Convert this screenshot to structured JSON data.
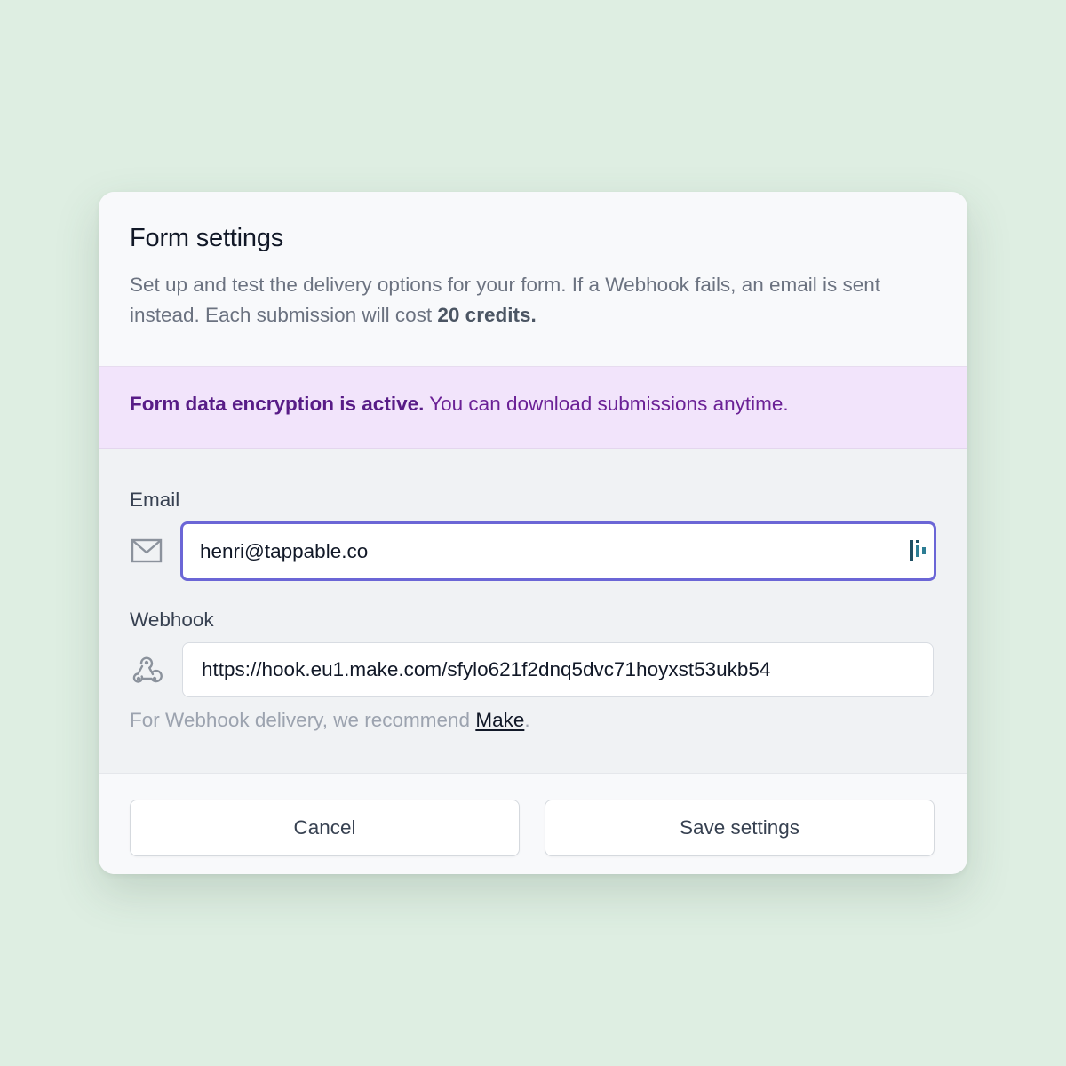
{
  "dialog": {
    "title": "Form settings",
    "description_prefix": "Set up and test the delivery options for your form. If a Webhook fails, an email is sent instead. Each submission will cost ",
    "description_bold": "20 credits."
  },
  "banner": {
    "strong": "Form data encryption is active.",
    "text": " You can download submissions anytime."
  },
  "email": {
    "label": "Email",
    "value": "henri@tappable.co",
    "icon": "envelope-icon"
  },
  "webhook": {
    "label": "Webhook",
    "value": "https://hook.eu1.make.com/sfylo621f2dnq5dvc71hoyxst53ukb54",
    "icon": "webhook-icon",
    "hint_prefix": "For Webhook delivery, we recommend ",
    "hint_link": "Make",
    "hint_suffix": "."
  },
  "footer": {
    "cancel_label": "Cancel",
    "save_label": "Save settings"
  },
  "colors": {
    "background": "#deeee2",
    "banner_bg": "#f2e4fb",
    "banner_text": "#6b2196",
    "focus_ring": "#6b66d6"
  }
}
